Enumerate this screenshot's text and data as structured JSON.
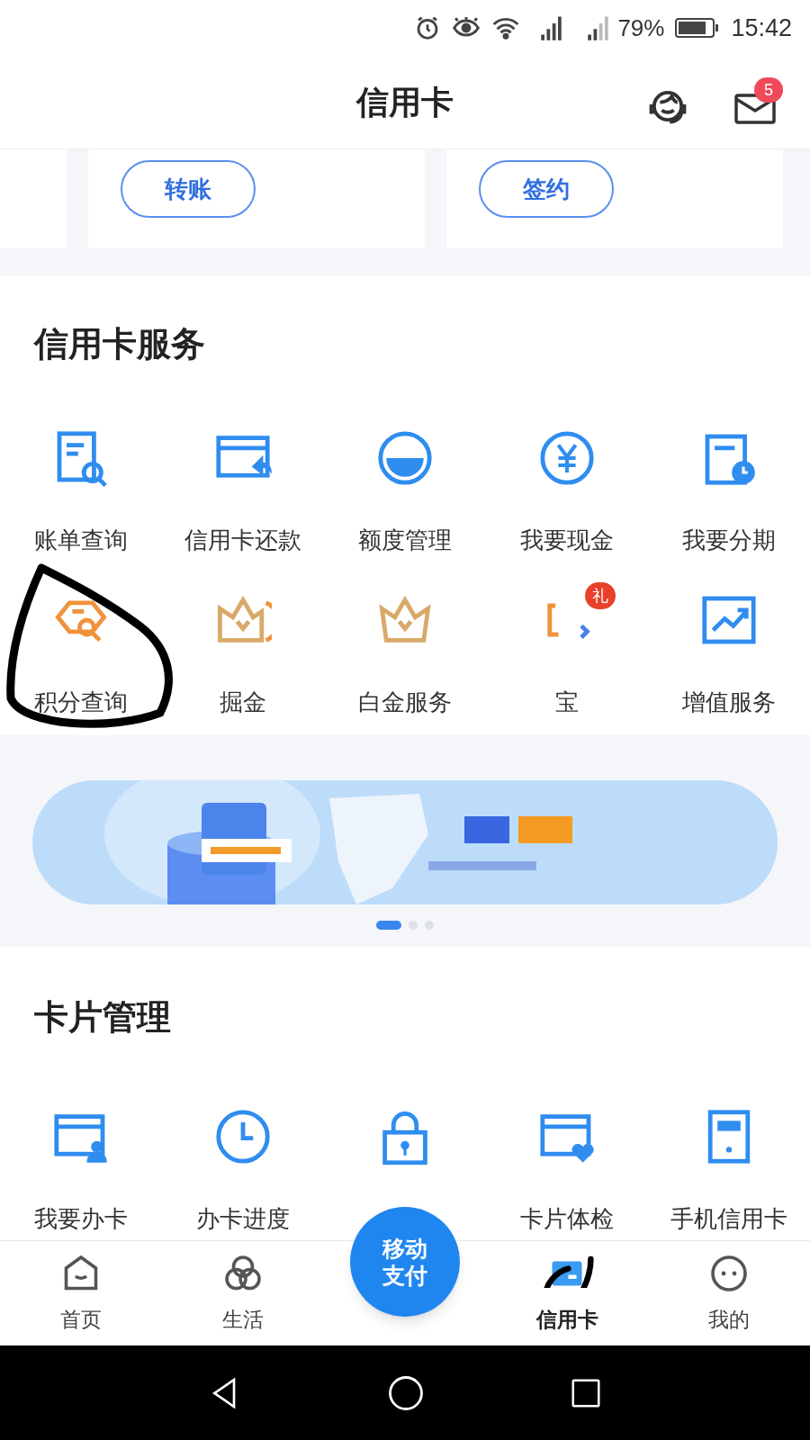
{
  "status_bar": {
    "battery": "79%",
    "time": "15:42"
  },
  "header": {
    "title": "信用卡",
    "mail_badge": "5"
  },
  "top_cards": [
    {
      "button": "转账"
    },
    {
      "button": "签约"
    }
  ],
  "services": {
    "title": "信用卡服务",
    "items": [
      {
        "label": "账单查询"
      },
      {
        "label": "信用卡还款"
      },
      {
        "label": "额度管理"
      },
      {
        "label": "我要现金"
      },
      {
        "label": "我要分期"
      },
      {
        "label": "积分查询"
      },
      {
        "label": "掘金"
      },
      {
        "label": "白金服务"
      },
      {
        "label": "宝",
        "badge": "礼"
      },
      {
        "label": "增值服务"
      }
    ]
  },
  "banner": {
    "kind": "picture",
    "dots": [
      {
        "selected": true
      },
      {
        "selected": false
      },
      {
        "selected": false
      }
    ]
  },
  "card_management": {
    "title": "卡片管理",
    "items": [
      {
        "label": "我要办卡"
      },
      {
        "label": "办卡进度"
      },
      {
        "kind": "icon_only"
      },
      {
        "label": "卡片体检"
      },
      {
        "label": "手机信用卡"
      }
    ]
  },
  "tab_bar": {
    "items": [
      {
        "label": "首页",
        "selected": false
      },
      {
        "label": "生活",
        "selected": false
      },
      {
        "label": "移动支付",
        "kind": "fab",
        "selected": false
      },
      {
        "label": "信用卡",
        "selected": true
      },
      {
        "label": "我的",
        "selected": false
      }
    ]
  }
}
